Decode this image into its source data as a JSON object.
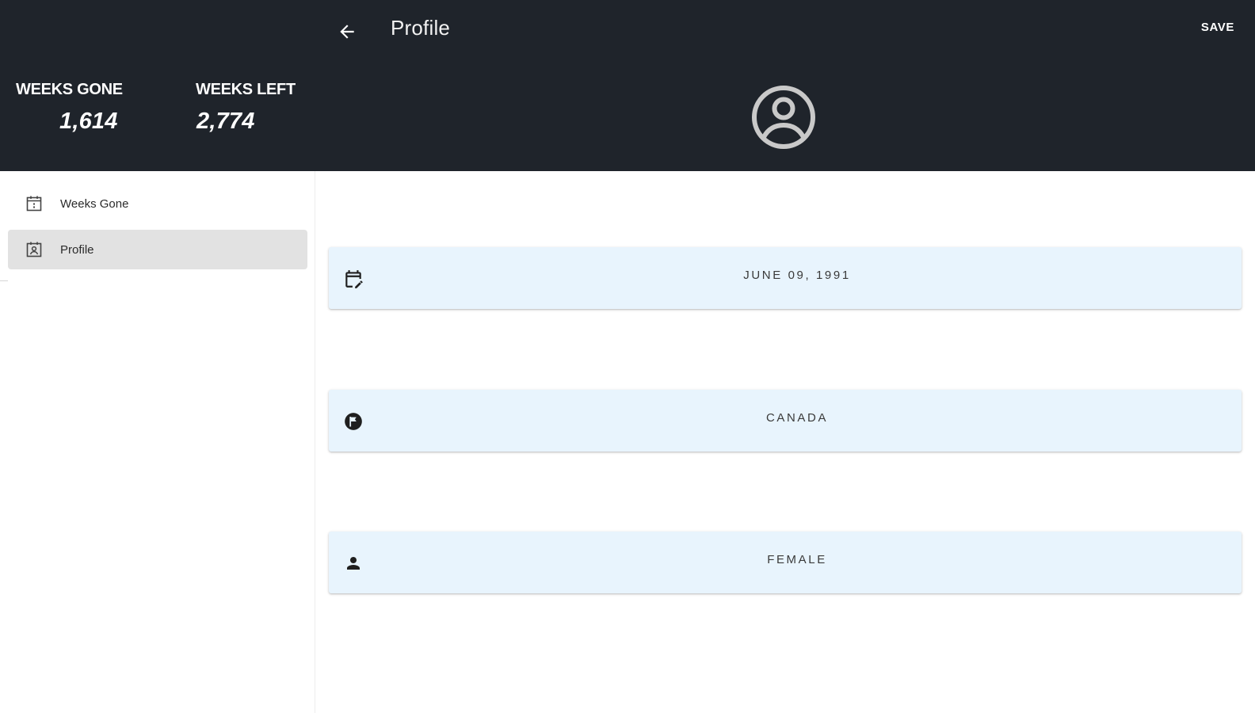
{
  "header": {
    "title": "Profile",
    "back_icon": "arrow-left-icon",
    "save_label": "SAVE",
    "background": "#1f242b"
  },
  "stats": {
    "weeks_gone_label": "WEEKS GONE",
    "weeks_gone_value": "1,614",
    "weeks_left_label": "WEEKS LEFT",
    "weeks_left_value": "2,774"
  },
  "avatar": {
    "icon": "account-circle-icon"
  },
  "sidebar": {
    "items": [
      {
        "label": "Weeks Gone",
        "icon": "calendar-icon",
        "active": false
      },
      {
        "label": "Profile",
        "icon": "profile-card-icon",
        "active": true
      }
    ]
  },
  "fields": {
    "birthdate": {
      "value": "JUNE 09, 1991",
      "icon": "calendar-edit-icon"
    },
    "country": {
      "value": "CANADA",
      "icon": "flag-circle-icon"
    },
    "gender": {
      "value": "FEMALE",
      "icon": "person-icon"
    }
  },
  "colors": {
    "field_background": "#e8f4fd",
    "active_nav": "#e2e2e2"
  }
}
